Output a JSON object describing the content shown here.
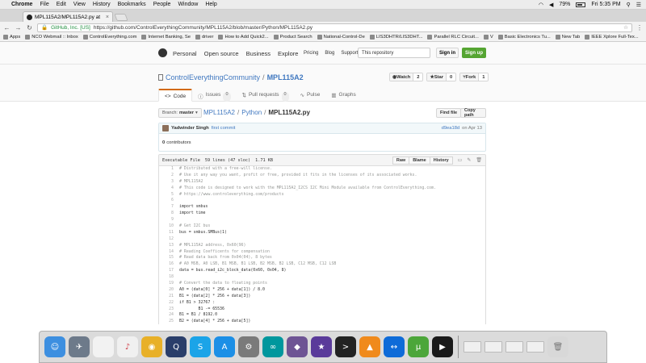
{
  "menubar": {
    "app_name": "Chrome",
    "items": [
      "File",
      "Edit",
      "View",
      "History",
      "Bookmarks",
      "People",
      "Window",
      "Help"
    ],
    "battery": "79%",
    "clock": "Fri 5:35 PM"
  },
  "browser": {
    "tab_title": "MPL115A2/MPL115A2.py at",
    "site_identity": "GitHub, Inc. [US]",
    "url": "https://github.com/ControlEverythingCommunity/MPL115A2/blob/master/Python/MPL115A2.py",
    "bookmarks": [
      "Apps",
      "NCO Webmail :: Inbox",
      "ControlEverything.com",
      "Internet Banking, Se",
      "driver",
      "How to Add Quick2...",
      "Product Search",
      "National-Control-De",
      "LIS3DHTR/LIS3DHT...",
      "Parallel RLC Circuit...",
      "V",
      "Basic Electronics Tu...",
      "New Tab",
      "IEEE Xplore Full-Tex..."
    ]
  },
  "github": {
    "nav": [
      "Personal",
      "Open source",
      "Business",
      "Explore"
    ],
    "right_nav": [
      "Pricing",
      "Blog",
      "Support"
    ],
    "search_placeholder": "This repository",
    "signin": "Sign in",
    "signup": "Sign up",
    "owner": "ControlEverythingCommunity",
    "repo": "MPL115A2",
    "actions": [
      {
        "label": "Watch",
        "count": "2"
      },
      {
        "label": "Star",
        "count": "0"
      },
      {
        "label": "Fork",
        "count": "1"
      }
    ],
    "tabs": [
      {
        "label": "Code",
        "count": ""
      },
      {
        "label": "Issues",
        "count": "0"
      },
      {
        "label": "Pull requests",
        "count": "0"
      },
      {
        "label": "Pulse",
        "count": ""
      },
      {
        "label": "Graphs",
        "count": ""
      }
    ],
    "branch_label": "Branch:",
    "branch": "master",
    "path": [
      "MPL115A2",
      "Python",
      "MPL115A2.py"
    ],
    "find_file": "Find file",
    "copy_path": "Copy path",
    "commit": {
      "author": "Yadwinder Singh",
      "message": "first commit",
      "sha": "d9ea18d",
      "date": "on Apr 13"
    },
    "contributors_count": "0",
    "contributors_label": "contributors",
    "file_info": {
      "type": "Executable File",
      "lines": "59 lines (47 sloc)",
      "size": "1.71 KB",
      "buttons": [
        "Raw",
        "Blame",
        "History"
      ]
    },
    "code": [
      {
        "n": "1",
        "t": "# Distributed with a free-will license."
      },
      {
        "n": "2",
        "t": "# Use it any way you want, profit or free, provided it fits in the licenses of its associated works."
      },
      {
        "n": "3",
        "t": "# MPL115A2"
      },
      {
        "n": "4",
        "t": "# This code is designed to work with the MPL115A2_I2CS I2C Mini Module available from ControlEverything.com."
      },
      {
        "n": "5",
        "t": "# https://www.controleverything.com/products"
      },
      {
        "n": "6",
        "t": ""
      },
      {
        "n": "7",
        "t": "import smbus"
      },
      {
        "n": "8",
        "t": "import time"
      },
      {
        "n": "9",
        "t": ""
      },
      {
        "n": "10",
        "t": "# Get I2C bus"
      },
      {
        "n": "11",
        "t": "bus = smbus.SMBus(1)"
      },
      {
        "n": "12",
        "t": ""
      },
      {
        "n": "13",
        "t": "# MPL115A2 address, 0x60(96)"
      },
      {
        "n": "14",
        "t": "# Reading Coefficents for compensation"
      },
      {
        "n": "15",
        "t": "# Read data back from 0x04(04), 8 bytes"
      },
      {
        "n": "16",
        "t": "# A0 MSB, A0 LSB, B1 MSB, B1 LSB, B2 MSB, B2 LSB, C12 MSB, C12 LSB"
      },
      {
        "n": "17",
        "t": "data = bus.read_i2c_block_data(0x60, 0x04, 8)"
      },
      {
        "n": "18",
        "t": ""
      },
      {
        "n": "19",
        "t": "# Convert the data to floating points"
      },
      {
        "n": "20",
        "t": "A0 = (data[0] * 256 + data[1]) / 8.0"
      },
      {
        "n": "21",
        "t": "B1 = (data[2] * 256 + data[3])"
      },
      {
        "n": "22",
        "t": "if B1 > 32767 :"
      },
      {
        "n": "23",
        "t": "        B1 -= 65536"
      },
      {
        "n": "24",
        "t": "B1 = B1 / 8192.0"
      },
      {
        "n": "25",
        "t": "B2 = (data[4] * 256 + data[5])"
      }
    ]
  },
  "dock": {
    "icons": [
      {
        "name": "finder-icon",
        "color": "#3d8fe0",
        "glyph": "☺"
      },
      {
        "name": "launchpad-icon",
        "color": "#6d7a8a",
        "glyph": "✈"
      },
      {
        "name": "notes-icon",
        "color": "#f2f2f2",
        "glyph": ""
      },
      {
        "name": "itunes-icon",
        "color": "#f0f0f0",
        "glyph": "♪"
      },
      {
        "name": "chrome-icon",
        "color": "#e8b028",
        "glyph": "◉"
      },
      {
        "name": "quicktime-icon",
        "color": "#2a3e6a",
        "glyph": "Q"
      },
      {
        "name": "skype-icon",
        "color": "#1ba4e8",
        "glyph": "S"
      },
      {
        "name": "app-store-icon",
        "color": "#1c8fe6",
        "glyph": "A"
      },
      {
        "name": "system-preferences-icon",
        "color": "#7a7a7a",
        "glyph": "⚙"
      },
      {
        "name": "arduino-icon",
        "color": "#00979d",
        "glyph": "∞"
      },
      {
        "name": "github-desktop-icon",
        "color": "#6e5494",
        "glyph": "◆"
      },
      {
        "name": "imovie-icon",
        "color": "#5a3a9a",
        "glyph": "★"
      },
      {
        "name": "terminal-icon",
        "color": "#222222",
        "glyph": ">"
      },
      {
        "name": "vlc-icon",
        "color": "#f08a1c",
        "glyph": "▲"
      },
      {
        "name": "teamviewer-icon",
        "color": "#0e6bd8",
        "glyph": "↔"
      },
      {
        "name": "utorrent-icon",
        "color": "#4ca63a",
        "glyph": "μ"
      },
      {
        "name": "media-player-icon",
        "color": "#1a1a1a",
        "glyph": "▶"
      }
    ],
    "windows": 4
  }
}
